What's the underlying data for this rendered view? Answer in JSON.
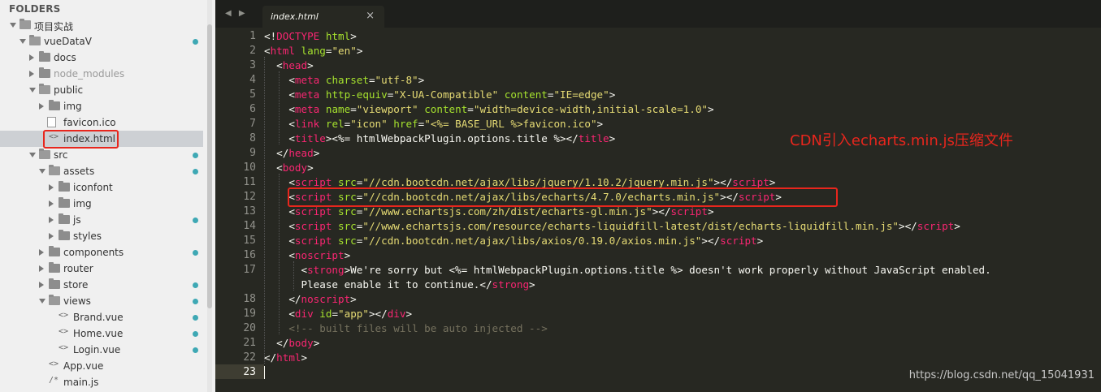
{
  "sidebar": {
    "header": "FOLDERS",
    "items": [
      {
        "label": "项目实战",
        "type": "folder",
        "open": true,
        "depth": 0,
        "dot": false
      },
      {
        "label": "vueDataV",
        "type": "folder",
        "open": true,
        "depth": 1,
        "dot": true
      },
      {
        "label": "docs",
        "type": "folder",
        "open": false,
        "depth": 2,
        "dot": false
      },
      {
        "label": "node_modules",
        "type": "folder",
        "open": false,
        "depth": 2,
        "dot": false,
        "dim": true
      },
      {
        "label": "public",
        "type": "folder",
        "open": true,
        "depth": 2,
        "dot": false
      },
      {
        "label": "img",
        "type": "folder",
        "open": false,
        "depth": 3,
        "dot": false
      },
      {
        "label": "favicon.ico",
        "type": "image-file",
        "depth": 3,
        "dot": false
      },
      {
        "label": "index.html",
        "type": "code-file",
        "depth": 3,
        "dot": false,
        "selected": true
      },
      {
        "label": "src",
        "type": "folder",
        "open": true,
        "depth": 2,
        "dot": true
      },
      {
        "label": "assets",
        "type": "folder",
        "open": true,
        "depth": 3,
        "dot": true
      },
      {
        "label": "iconfont",
        "type": "folder",
        "open": false,
        "depth": 4,
        "dot": false
      },
      {
        "label": "img",
        "type": "folder",
        "open": false,
        "depth": 4,
        "dot": false
      },
      {
        "label": "js",
        "type": "folder",
        "open": false,
        "depth": 4,
        "dot": true
      },
      {
        "label": "styles",
        "type": "folder",
        "open": false,
        "depth": 4,
        "dot": false
      },
      {
        "label": "components",
        "type": "folder",
        "open": false,
        "depth": 3,
        "dot": true
      },
      {
        "label": "router",
        "type": "folder",
        "open": false,
        "depth": 3,
        "dot": false
      },
      {
        "label": "store",
        "type": "folder",
        "open": false,
        "depth": 3,
        "dot": true
      },
      {
        "label": "views",
        "type": "folder",
        "open": true,
        "depth": 3,
        "dot": true
      },
      {
        "label": "Brand.vue",
        "type": "code-file",
        "depth": 4,
        "dot": true
      },
      {
        "label": "Home.vue",
        "type": "code-file",
        "depth": 4,
        "dot": true
      },
      {
        "label": "Login.vue",
        "type": "code-file",
        "depth": 4,
        "dot": true
      },
      {
        "label": "App.vue",
        "type": "code-file",
        "depth": 3,
        "dot": false
      },
      {
        "label": "main.js",
        "type": "comment-file",
        "depth": 3,
        "dot": false
      }
    ]
  },
  "tabs": {
    "nav": "◀ ▶",
    "active": "index.html",
    "close": "×"
  },
  "editor": {
    "line_numbers": [
      "1",
      "2",
      "3",
      "4",
      "5",
      "6",
      "7",
      "8",
      "9",
      "10",
      "11",
      "12",
      "13",
      "14",
      "15",
      "16",
      "17",
      "",
      "18",
      "19",
      "20",
      "21",
      "22",
      "23"
    ],
    "current_line": "23"
  },
  "annotation": "CDN引入echarts.min.js压缩文件",
  "watermark": "https://blog.csdn.net/qq_15041931",
  "colors": {
    "background": "#272822",
    "tag": "#f92672",
    "attr": "#a6e22e",
    "string": "#e6db74",
    "comment": "#75715e",
    "highlight": "#e8261d",
    "dot": "#3ea8b4"
  }
}
